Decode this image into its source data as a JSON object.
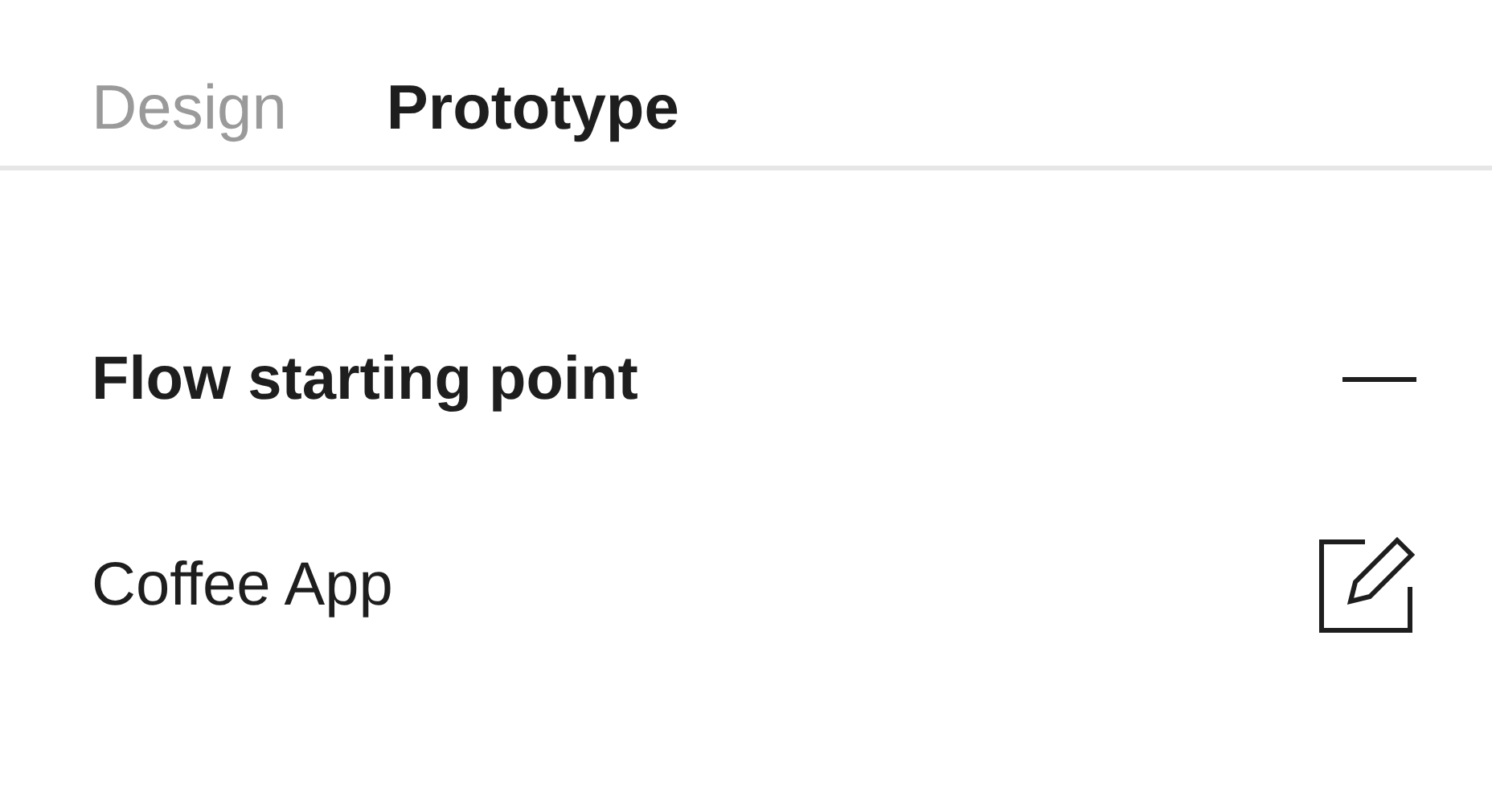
{
  "tabs": [
    {
      "label": "Design",
      "selected": false
    },
    {
      "label": "Prototype",
      "selected": true
    }
  ],
  "section": {
    "title": "Flow starting point",
    "expanded": true,
    "items": [
      {
        "label": "Coffee App"
      }
    ]
  }
}
